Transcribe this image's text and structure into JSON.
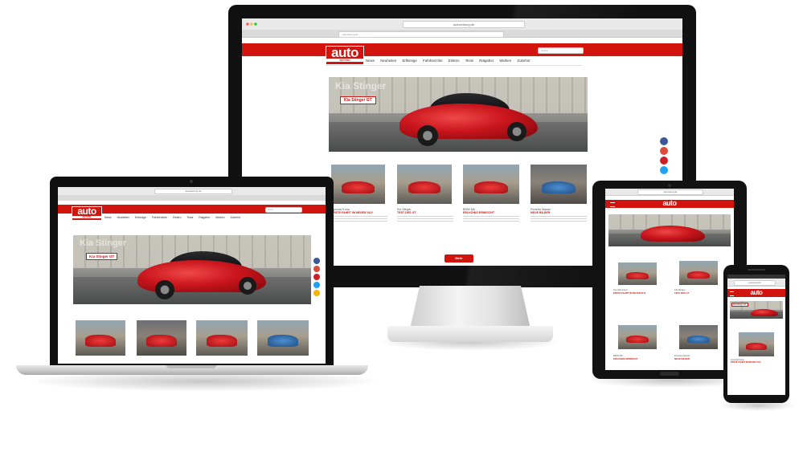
{
  "site": {
    "logo_text": "auto",
    "logo_sub": "ZEITUNG",
    "url": "autozeitung.de",
    "search_placeholder": "Suche",
    "nav": [
      "News",
      "Neuheiten",
      "Erlkönige",
      "Fahrberichte",
      "Elektro",
      "Tests",
      "Ratgeber",
      "Marken",
      "Zubehör"
    ]
  },
  "hero": {
    "ribbon": "Kia Stinger GT",
    "ghost": "Kia Stinger"
  },
  "articles": [
    {
      "kicker": "Hyundai Kona",
      "title": "ERSTE FAHRT IM NEUEN SUV"
    },
    {
      "kicker": "Kia Stinger",
      "title": "TEST DES GT"
    },
    {
      "kicker": "BMW M8",
      "title": "ERLKÖNIG ERWISCHT"
    },
    {
      "kicker": "Porsche Macan",
      "title": "NEUE BILDER"
    }
  ],
  "more_button": "Mehr",
  "colors": {
    "brand_red": "#d2140f",
    "facebook": "#3b5998",
    "google": "#dd4b39",
    "pinterest": "#cb2027",
    "twitter": "#1da1f2",
    "whatsapp": "#f5b400"
  },
  "social_icons": [
    "facebook-icon",
    "google-plus-icon",
    "pinterest-icon",
    "twitter-icon",
    "whatsapp-icon"
  ]
}
